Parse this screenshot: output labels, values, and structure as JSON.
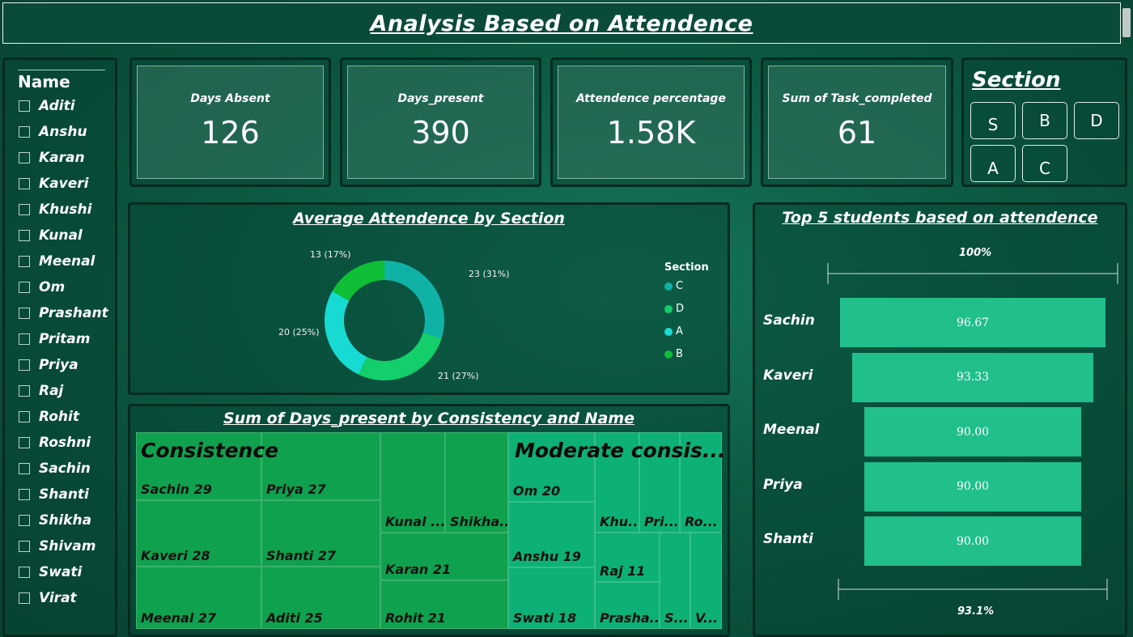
{
  "header": {
    "title": "Analysis Based on Attendence"
  },
  "name_slicer": {
    "title": "Name",
    "items": [
      "Aditi",
      "Anshu",
      "Karan",
      "Kaveri",
      "Khushi",
      "Kunal",
      "Meenal",
      "Om",
      "Prashant",
      "Pritam",
      "Priya",
      "Raj",
      "Rohit",
      "Roshni",
      "Sachin",
      "Shanti",
      "Shikha",
      "Shivam",
      "Swati",
      "Virat"
    ]
  },
  "cards": [
    {
      "label": "Days Absent",
      "value": "126"
    },
    {
      "label": "Days_present",
      "value": "390"
    },
    {
      "label": "Attendence percentage",
      "value": "1.58K"
    },
    {
      "label": "Sum of Task_completed",
      "value": "61"
    }
  ],
  "section_slicer": {
    "title": "Section",
    "options": [
      "S",
      "B",
      "D",
      "A",
      "C"
    ]
  },
  "donut": {
    "title": "Average Attendence by Section",
    "legend_title": "Section",
    "labels": [
      "23 (31%)",
      "21 (27%)",
      "20 (25%)",
      "13 (17%)"
    ]
  },
  "treemap": {
    "title": "Sum of Days_present by Consistency and Name",
    "groups": [
      "Consistence",
      "Moderate consis..."
    ],
    "tiles": [
      "Sachin 29",
      "Priya 27",
      "Kaveri 28",
      "Shanti 27",
      "Meenal 27",
      "Aditi 25",
      "Kunal ...",
      "Shikha...",
      "Karan 21",
      "Rohit 21",
      "Om 20",
      "Anshu 19",
      "Swati 18",
      "Khu...",
      "Pri...",
      "Ro...",
      "Raj 11",
      "Prasha...",
      "S...",
      "V..."
    ]
  },
  "bar_chart": {
    "title": "Top 5 students based on attendence",
    "top_axis_label": "100%",
    "bottom_axis_label": "93.1%",
    "value_labels": [
      "96.67",
      "93.33",
      "90.00",
      "90.00",
      "90.00"
    ]
  },
  "chart_data": [
    {
      "type": "pie",
      "title": "Average Attendence by Section",
      "legend_title": "Section",
      "legend_position": "right",
      "categories": [
        "C",
        "D",
        "A",
        "B"
      ],
      "values": [
        23,
        21,
        20,
        13
      ],
      "percent_labels": [
        "31%",
        "27%",
        "25%",
        "17%"
      ],
      "colors": [
        "#10b2a6",
        "#12cf6b",
        "#17dbd3",
        "#0fbf36"
      ]
    },
    {
      "type": "bar",
      "title": "Top 5 students based on attendence",
      "categories": [
        "Sachin",
        "Kaveri",
        "Meenal",
        "Priya",
        "Shanti"
      ],
      "values": [
        96.67,
        93.33,
        90.0,
        90.0,
        90.0
      ],
      "orientation": "horizontal",
      "color": "#21bf8b"
    },
    {
      "type": "heatmap",
      "title": "Sum of Days_present by Consistency and Name",
      "groups": [
        {
          "name": "Consistence",
          "color": "#10a14f",
          "items": [
            {
              "name": "Sachin",
              "value": 29
            },
            {
              "name": "Priya",
              "value": 27
            },
            {
              "name": "Kaveri",
              "value": 28
            },
            {
              "name": "Shanti",
              "value": 27
            },
            {
              "name": "Meenal",
              "value": 27
            },
            {
              "name": "Aditi",
              "value": 25
            },
            {
              "name": "Kunal",
              "value": null
            },
            {
              "name": "Shikha",
              "value": null
            },
            {
              "name": "Karan",
              "value": 21
            },
            {
              "name": "Rohit",
              "value": 21
            }
          ]
        },
        {
          "name": "Moderate consis...",
          "color": "#0db075",
          "items": [
            {
              "name": "Om",
              "value": 20
            },
            {
              "name": "Anshu",
              "value": 19
            },
            {
              "name": "Swati",
              "value": 18
            },
            {
              "name": "Raj",
              "value": 11
            },
            {
              "name": "Khu...",
              "value": null
            },
            {
              "name": "Pri...",
              "value": null
            },
            {
              "name": "Ro...",
              "value": null
            },
            {
              "name": "Prasha...",
              "value": null
            },
            {
              "name": "S...",
              "value": null
            },
            {
              "name": "V...",
              "value": null
            }
          ]
        }
      ]
    }
  ]
}
